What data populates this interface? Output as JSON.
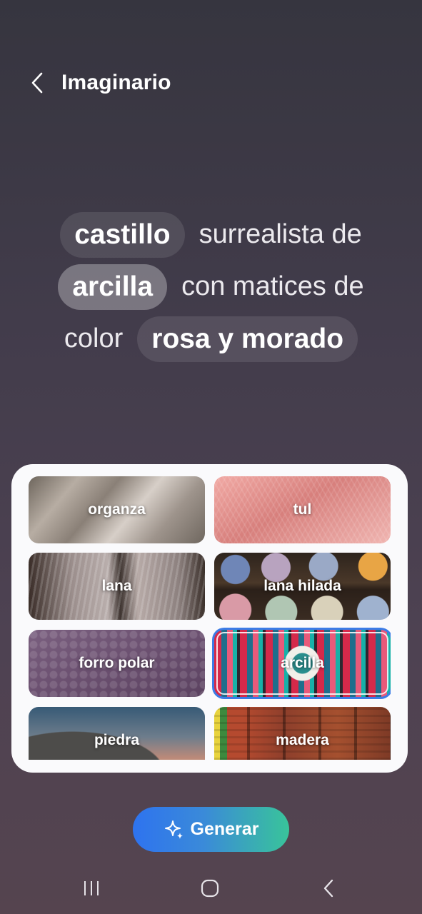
{
  "header": {
    "title": "Imaginario",
    "back_icon": "chevron-left-icon"
  },
  "prompt": {
    "line1": {
      "chip": "castillo",
      "text": "surrealista de"
    },
    "line2": {
      "chip": "arcilla",
      "text": "con matices de"
    },
    "line3": {
      "text": "color",
      "chip": "rosa y morado"
    }
  },
  "styles": [
    {
      "label": "organza",
      "selected": false
    },
    {
      "label": "tul",
      "selected": false
    },
    {
      "label": "lana",
      "selected": false
    },
    {
      "label": "lana hilada",
      "selected": false
    },
    {
      "label": "forro polar",
      "selected": false
    },
    {
      "label": "arcilla",
      "selected": true
    },
    {
      "label": "piedra",
      "selected": false
    },
    {
      "label": "madera",
      "selected": false
    }
  ],
  "generate": {
    "label": "Generar",
    "icon": "sparkle-icon"
  },
  "navbar": {
    "recents_icon": "recents-icon",
    "home_icon": "home-icon",
    "back_icon": "back-icon"
  },
  "colors": {
    "accent_blue": "#2e73ef",
    "accent_green": "#39c49a",
    "selection": "#3c7ce6"
  }
}
